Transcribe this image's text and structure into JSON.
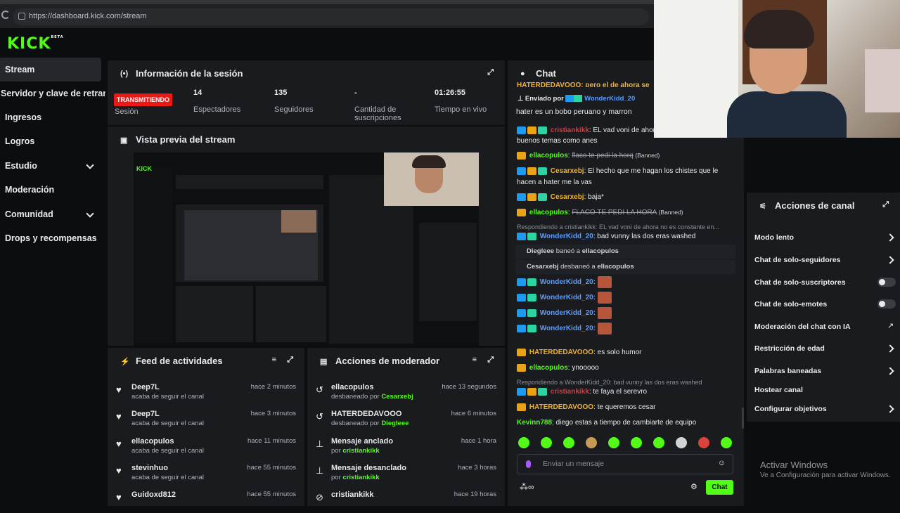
{
  "browser": {
    "url": "https://dashboard.kick.com/stream"
  },
  "brand": {
    "logo": "KICK",
    "beta": "BETA",
    "accent": "#53fc18"
  },
  "sidebar": {
    "items": [
      {
        "label": "Stream",
        "active": true
      },
      {
        "label": "Servidor y clave de retransmisión"
      },
      {
        "label": "Ingresos"
      },
      {
        "label": "Logros"
      },
      {
        "label": "Estudio",
        "expandable": true
      },
      {
        "label": "Moderación"
      },
      {
        "label": "Comunidad",
        "expandable": true
      },
      {
        "label": "Drops y recompensas"
      }
    ]
  },
  "session": {
    "title": "Información de la sesión",
    "badge": "TRANSMITIENDO",
    "stats": [
      {
        "value": "",
        "label": "Sesión"
      },
      {
        "value": "14",
        "label": "Espectadores"
      },
      {
        "value": "135",
        "label": "Seguidores"
      },
      {
        "value": "-",
        "label": "Cantidad de suscripciones"
      },
      {
        "value": "01:26:55",
        "label": "Tiempo en vivo"
      }
    ]
  },
  "preview": {
    "title": "Vista previa del stream"
  },
  "feed": {
    "title": "Feed de actividades",
    "items": [
      {
        "name": "Deep7L",
        "sub": "acaba de seguir el canal",
        "time": "hace 2 minutos"
      },
      {
        "name": "Deep7L",
        "sub": "acaba de seguir el canal",
        "time": "hace 3 minutos"
      },
      {
        "name": "ellacopulos",
        "sub": "acaba de seguir el canal",
        "time": "hace 11 minutos"
      },
      {
        "name": "stevinhuo",
        "sub": "acaba de seguir el canal",
        "time": "hace 55 minutos"
      },
      {
        "name": "Guidoxd812",
        "sub": "",
        "time": "hace 55 minutos"
      }
    ]
  },
  "modactions": {
    "title": "Acciones de moderador",
    "items": [
      {
        "name": "ellacopulos",
        "pre": "desbaneado por",
        "by": "Cesarxebj",
        "time": "hace 13 segundos"
      },
      {
        "name": "HATERDEDAVOOO",
        "pre": "desbaneado por",
        "by": "Diegleee",
        "time": "hace 6 minutos"
      },
      {
        "name": "Mensaje anclado",
        "pre": "por",
        "by": "cristiankikk",
        "time": "hace 1 hora"
      },
      {
        "name": "Mensaje desanclado",
        "pre": "por",
        "by": "cristiankikk",
        "time": "hace 3 horas"
      },
      {
        "name": "cristiankikk",
        "pre": "",
        "by": "",
        "time": "hace 19 horas"
      }
    ]
  },
  "chat": {
    "title": "Chat",
    "top_cut": "HATERDEDAVOOO: pero el de ahora se",
    "pinned": {
      "prefix": "Enviado por",
      "user": "WonderKidd_20",
      "text": "hater es un bobo peruano y marron"
    },
    "m1": {
      "user": "cristiankikk",
      "text": ": EL vad voni de ahora no",
      "text2": "buenos temas como anes"
    },
    "m2": {
      "user": "ellacopulos",
      "text": "flaco te pedi la horq",
      "tag": "(Banned)"
    },
    "m3": {
      "user": "Cesarxebj",
      "text": ": El hecho que me hagan los chistes que le",
      "text2": "hacen a hater me la vas"
    },
    "m4": {
      "user": "Cesarxebj",
      "text": ": baja*"
    },
    "m5": {
      "user": "ellacopulos",
      "text": "FLACO TE PEDI LA HORA",
      "tag": "(Banned)"
    },
    "r1": "Respondiendo a cristiankikk: EL vad voni de ahora no es constante en...",
    "m6": {
      "user": "WonderKidd_20",
      "text": ": bad vunny las dos eras washed"
    },
    "sys1": {
      "who": "Diegleee",
      "action": "baneó a",
      "target": "ellacopulos"
    },
    "sys2": {
      "who": "Cesarxebj",
      "action": "desbaneó a",
      "target": "ellacopulos"
    },
    "em_user": "WonderKidd_20:",
    "m7": {
      "user": "HATERDEDAVOOO",
      "text": ": es solo humor"
    },
    "m8": {
      "user": "ellacopulos",
      "text": ": ynooooo"
    },
    "r2": "Respondiendo a WonderKidd_20: bad vunny las dos eras washed",
    "m9": {
      "user": "cristiankikk",
      "text": ": te faya el serevro"
    },
    "m10": {
      "user": "HATERDEDAVOOO",
      "text": ": te queremos cesar"
    },
    "m11": {
      "user": "Kevinn788",
      "text": ": diego estas a tiempo de cambiarte de equipo"
    },
    "input_placeholder": "Enviar un mensaje",
    "send": "Chat"
  },
  "actions": {
    "title": "Acciones de canal",
    "items": [
      {
        "label": "Modo lento",
        "kind": "arrow"
      },
      {
        "label": "Chat de solo-seguidores",
        "kind": "arrow"
      },
      {
        "label": "Chat de solo-suscriptores",
        "kind": "toggle"
      },
      {
        "label": "Chat de solo-emotes",
        "kind": "toggle"
      },
      {
        "label": "Moderación del chat con IA",
        "kind": "external"
      },
      {
        "label": "Restricción de edad",
        "kind": "arrow"
      },
      {
        "label": "Palabras baneadas",
        "kind": "arrow"
      },
      {
        "label": "Hostear canal",
        "kind": "none"
      },
      {
        "label": "Configurar objetivos",
        "kind": "arrow"
      }
    ]
  },
  "windows": {
    "line1": "Activar Windows",
    "line2": "Ve a Configuración para activar Windows."
  }
}
